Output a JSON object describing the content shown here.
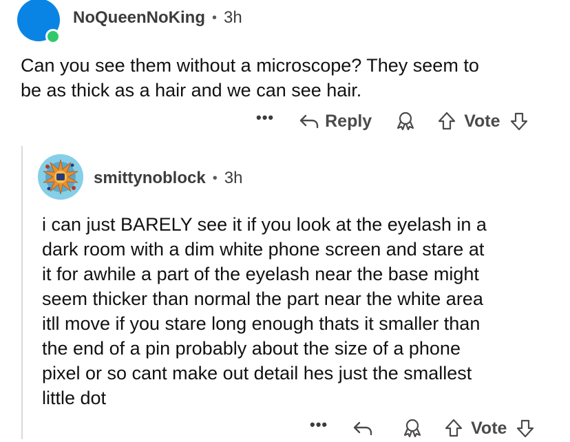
{
  "top_comment": {
    "username": "NoQueenNoKing",
    "separator": "•",
    "time": "3h",
    "text": "Can you see them without a microscope? They seem to\nbe as thick as a hair and we can see hair.",
    "actions": {
      "more": "•••",
      "reply_label": "Reply",
      "vote_label": "Vote"
    }
  },
  "reply_comment": {
    "username": "smittynoblock",
    "separator": "•",
    "time": "3h",
    "text": "i can just BARELY see it if you look at the eyelash in a\ndark room with a dim white phone screen and stare at\nit for awhile a part of the eyelash near the base might\nseem thicker than normal the part near the white area\nitll move if you stare long enough thats it smaller than\nthe end of a pin probably about the size of a phone\npixel or so cant make out detail hes just the smallest\nlittle dot",
    "actions": {
      "more": "•••",
      "vote_label": "Vote"
    }
  },
  "colors": {
    "avatar_top": "#0a84e4",
    "online": "#2fc96b",
    "thread_line": "#d9d9d9"
  }
}
